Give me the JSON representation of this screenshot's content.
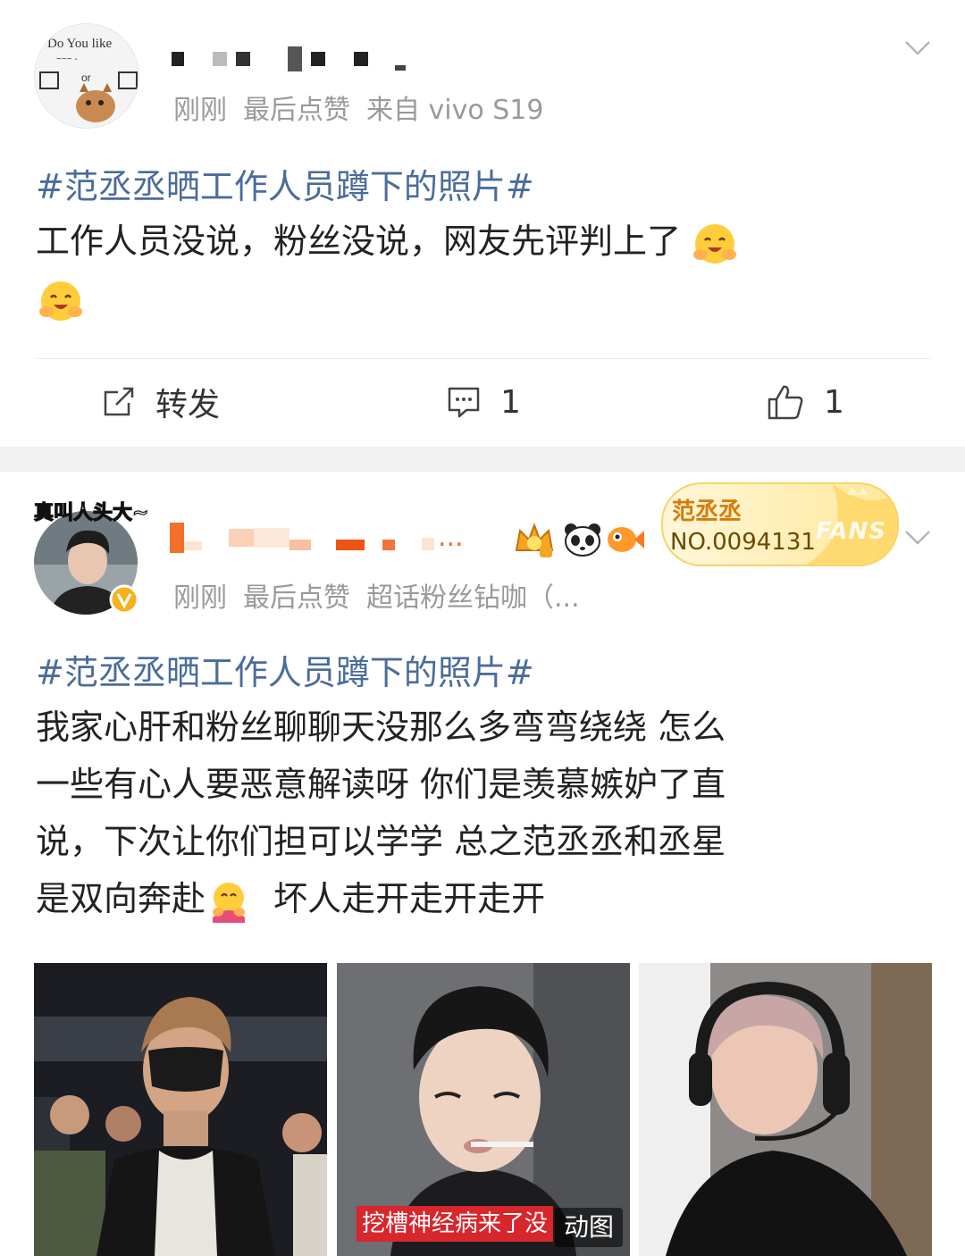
{
  "posts": [
    {
      "avatar_text": "Do You like / or / es / Yo",
      "time": "刚刚",
      "like_status": "最后点赞",
      "source": "来自 vivo S19",
      "hashtag": "#范丞丞晒工作人员蹲下的照片#",
      "text_lines": [
        "工作人员没说，粉丝没说，网友先评判上了"
      ],
      "actions": {
        "repost": "转发",
        "comment_count": "1",
        "like_count": "1"
      }
    },
    {
      "avatar_banner": "真叫人头大~",
      "username_tail": "...",
      "fans_badge": {
        "name": "范丞丞",
        "number": "NO.0094131",
        "word": "FANS"
      },
      "time": "刚刚",
      "like_status": "最后点赞",
      "source": "超话粉丝钻咖（...",
      "hashtag": "#范丞丞晒工作人员蹲下的照片#",
      "text_lines": [
        "我家心肝和粉丝聊聊天没那么多弯弯绕绕  怎么",
        "一些有心人要恶意解读呀  你们是羡慕嫉妒了直",
        "说，下次让你们担可以学学  总之范丞丞和丞星",
        "是双向奔赴",
        "  坏人走开走开走开"
      ],
      "images": [
        {
          "caption": ""
        },
        {
          "caption": "挖槽神经病来了没",
          "tag": "动图"
        },
        {
          "caption": ""
        }
      ]
    }
  ],
  "icons": {
    "chevron": "chevron-down-icon",
    "repost": "repost-icon",
    "comment": "comment-icon",
    "like": "thumbs-up-icon",
    "emoji": "hug-emoji-icon",
    "verified": "verified-badge-icon"
  },
  "colors": {
    "hashtag": "#4b6c9c",
    "meta": "#9a9a9a",
    "badge_text": "#d77a0a",
    "separator": "#f2f2f2",
    "caption_bg": "#d8262d"
  }
}
